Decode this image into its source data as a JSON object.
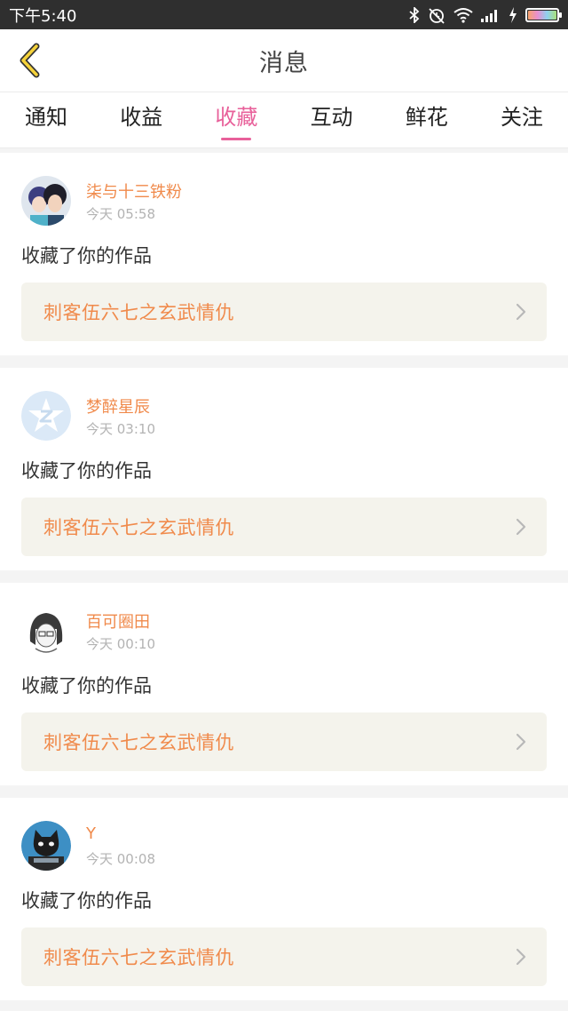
{
  "status_bar": {
    "time": "下午5:40",
    "icons": [
      "bluetooth-icon",
      "alarm-off-icon",
      "wifi-icon",
      "signal-icon",
      "charging-icon",
      "battery-icon"
    ]
  },
  "header": {
    "title": "消息",
    "back_icon": "chevron-left-icon"
  },
  "tabs": [
    {
      "label": "通知",
      "active": false
    },
    {
      "label": "收益",
      "active": false
    },
    {
      "label": "收藏",
      "active": true
    },
    {
      "label": "互动",
      "active": false
    },
    {
      "label": "鲜花",
      "active": false
    },
    {
      "label": "关注",
      "active": false
    }
  ],
  "colors": {
    "accent": "#e8609a",
    "username": "#f08a4b",
    "link_bg": "#f4f3ec"
  },
  "notifications": [
    {
      "username": "柒与十三铁粉",
      "time": "今天 05:58",
      "action": "收藏了你的作品",
      "work_title": "刺客伍六七之玄武情仇",
      "avatar": "anime-couple-avatar"
    },
    {
      "username": "梦醉星辰",
      "time": "今天 03:10",
      "action": "收藏了你的作品",
      "work_title": "刺客伍六七之玄武情仇",
      "avatar": "default-z-avatar"
    },
    {
      "username": "百可圈田",
      "time": "今天 00:10",
      "action": "收藏了你的作品",
      "work_title": "刺客伍六七之玄武情仇",
      "avatar": "sketch-girl-avatar"
    },
    {
      "username": "Y",
      "time": "今天 00:08",
      "action": "收藏了你的作品",
      "work_title": "刺客伍六七之玄武情仇",
      "avatar": "black-cat-avatar"
    }
  ]
}
